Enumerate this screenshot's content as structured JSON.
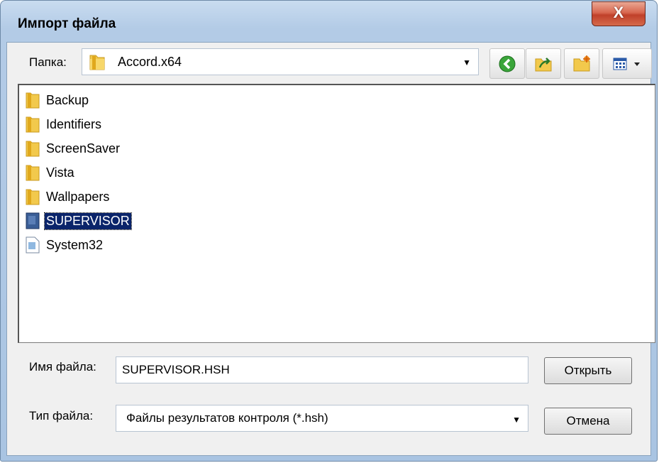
{
  "window": {
    "title": "Импорт файла",
    "close_glyph": "X"
  },
  "location": {
    "label": "Папка:",
    "folder": "Accord.x64",
    "icon": "folder-icon"
  },
  "toolbar": {
    "buttons": [
      {
        "name": "back-button",
        "icon": "back-arrow-icon"
      },
      {
        "name": "up-folder-button",
        "icon": "up-folder-icon"
      },
      {
        "name": "new-folder-button",
        "icon": "new-folder-icon"
      },
      {
        "name": "view-menu-button",
        "icon": "view-list-icon"
      }
    ]
  },
  "files": [
    {
      "label": "Backup",
      "type": "folder"
    },
    {
      "label": "Identifiers",
      "type": "folder"
    },
    {
      "label": "ScreenSaver",
      "type": "folder"
    },
    {
      "label": "Vista",
      "type": "folder"
    },
    {
      "label": "Wallpapers",
      "type": "folder"
    },
    {
      "label": "SUPERVISOR",
      "type": "file-dark",
      "selected": true
    },
    {
      "label": "System32",
      "type": "file"
    }
  ],
  "filename": {
    "label": "Имя файла:",
    "value": "SUPERVISOR.HSH"
  },
  "filetype": {
    "label": "Тип файла:",
    "value": "Файлы результатов контроля (*.hsh)"
  },
  "buttons": {
    "open": "Открыть",
    "cancel": "Отмена"
  },
  "colors": {
    "selection": "#0a246a",
    "titlebar": "#b3cbe6",
    "close": "#c0402a"
  }
}
